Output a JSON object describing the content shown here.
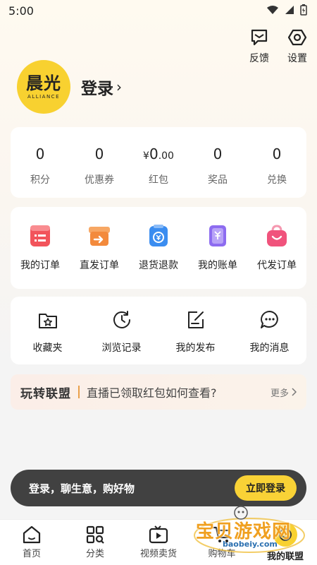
{
  "status_bar": {
    "time": "5:00"
  },
  "header": {
    "feedback_label": "反馈",
    "settings_label": "设置"
  },
  "profile": {
    "logo_cn": "晨光",
    "logo_en": "ALLIANCE",
    "login_text": "登录",
    "chevron": "›"
  },
  "stats": [
    {
      "value": "0",
      "label": "积分"
    },
    {
      "value": "0",
      "label": "优惠券"
    },
    {
      "currency": "¥",
      "value": "0",
      "decimals": ".00",
      "label": "红包"
    },
    {
      "value": "0",
      "label": "奖品"
    },
    {
      "value": "0",
      "label": "兑换"
    }
  ],
  "orders": [
    {
      "label": "我的订单",
      "icon": "order-list-icon",
      "color": "#f2545b"
    },
    {
      "label": "直发订单",
      "icon": "direct-ship-icon",
      "color": "#f38a3c"
    },
    {
      "label": "退货退款",
      "icon": "refund-icon",
      "color": "#3b8df0"
    },
    {
      "label": "我的账单",
      "icon": "bill-icon",
      "color": "#8d6cf0"
    },
    {
      "label": "代发订单",
      "icon": "proxy-order-icon",
      "color": "#f0537c"
    }
  ],
  "tools": [
    {
      "label": "收藏夹",
      "icon": "favorites-icon"
    },
    {
      "label": "浏览记录",
      "icon": "history-icon"
    },
    {
      "label": "我的发布",
      "icon": "publish-icon"
    },
    {
      "label": "我的消息",
      "icon": "message-icon"
    }
  ],
  "alliance": {
    "title": "玩转联盟",
    "message": "直播已领取红包如何查看?",
    "more": "更多"
  },
  "login_bar": {
    "message": "登录，聊生意，购好物",
    "button": "立即登录"
  },
  "tabs": [
    {
      "label": "首页",
      "icon": "home-icon"
    },
    {
      "label": "分类",
      "icon": "category-icon"
    },
    {
      "label": "视频卖货",
      "icon": "video-icon"
    },
    {
      "label": "购物车",
      "icon": "cart-icon"
    },
    {
      "label": "我的联盟",
      "icon": "alliance-icon",
      "active": true
    }
  ],
  "watermark": {
    "text": "宝贝游戏网",
    "url": "baobeiy.com"
  },
  "colors": {
    "accent_yellow": "#f8d130",
    "login_button": "#f9d236",
    "login_bar_bg": "#282828"
  }
}
